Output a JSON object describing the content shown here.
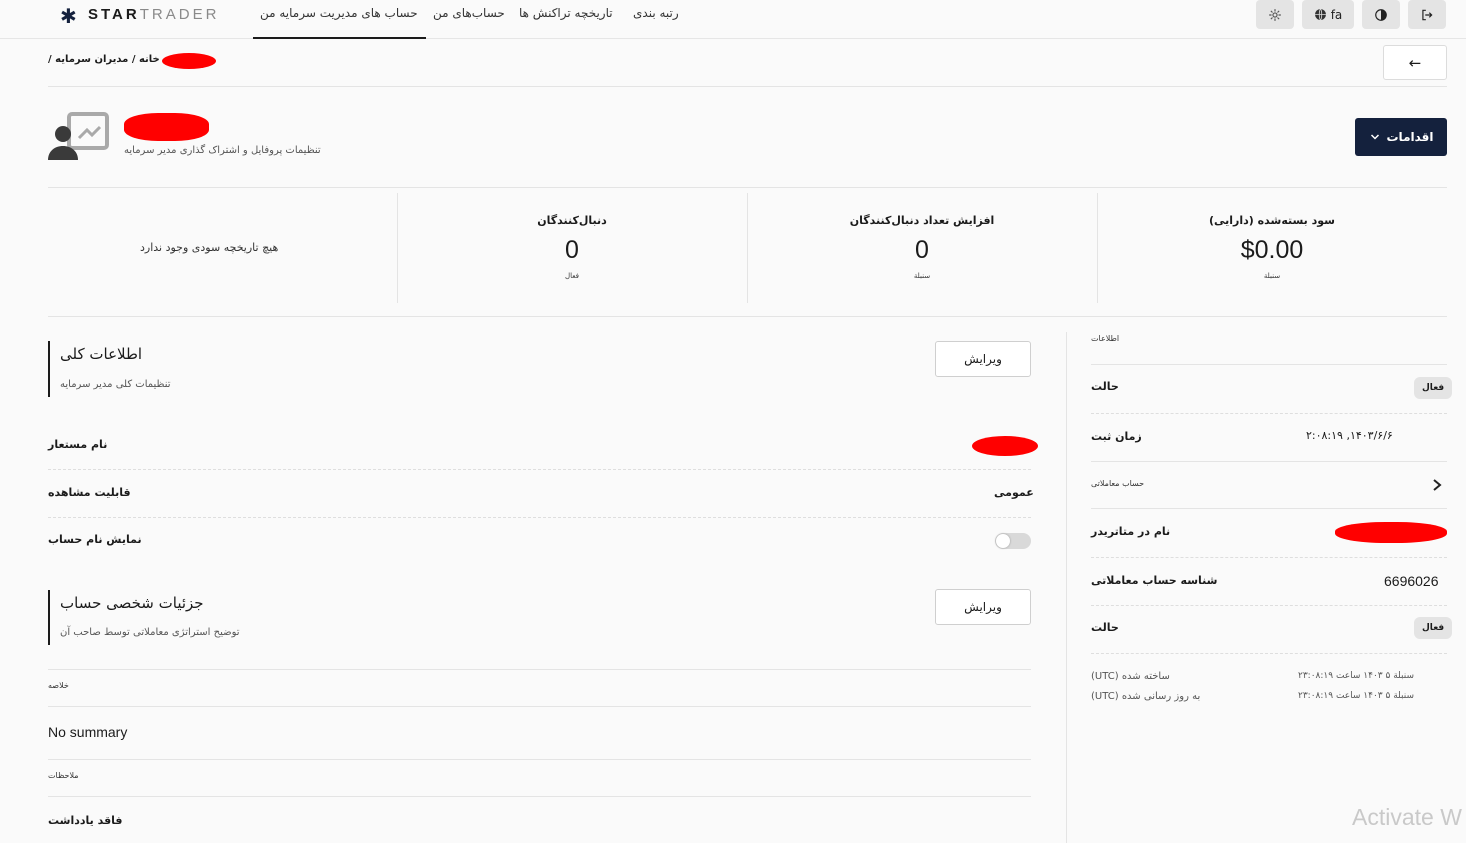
{
  "brand": {
    "logo_a": "STAR",
    "logo_b": "TRADER"
  },
  "nav": {
    "items": [
      {
        "label": "حساب های مدیریت سرمایه من",
        "active": true
      },
      {
        "label": "حساب‌های من"
      },
      {
        "label": "تاریخچه تراکنش ها"
      },
      {
        "label": "رتبه بندی"
      }
    ]
  },
  "top_actions": {
    "language": "fa"
  },
  "breadcrumb": {
    "home": "خانه",
    "sep1": "/",
    "section": "مدیران سرمایه",
    "sep2": "/"
  },
  "profile": {
    "subtitle": "تنظیمات پروفایل و اشتراک گذاری مدیر سرمایه",
    "actions_label": "اقدامات"
  },
  "stats": {
    "no_history": "هیچ تاریخچه سودی وجود ندارد",
    "followers": {
      "label": "دنبال‌کنندگان",
      "value": "0",
      "sub": "فعال"
    },
    "followers_increase": {
      "label": "افزایش تعداد دنبال‌کنندگان",
      "value": "0",
      "sub": "سنبلة"
    },
    "closed_profit": {
      "label": "سود بسته‌شده (دارایی)",
      "value": "$0.00",
      "sub": "سنبلة"
    }
  },
  "general": {
    "title": "اطلاعات کلی",
    "subtitle": "تنظیمات کلی مدیر سرمایه",
    "edit_label": "ویرایش",
    "alias_label": "نام مستعار",
    "visibility_label": "قابلیت مشاهده",
    "visibility_value": "عمومی",
    "show_account_label": "نمایش نام حساب",
    "show_account_enabled": false
  },
  "personal": {
    "title": "جزئیات شخصی حساب",
    "subtitle": "توضیح استراتژی معاملاتی توسط صاحب آن",
    "edit_label": "ویرایش",
    "summary_label": "خلاصه",
    "summary_value": "No summary",
    "notes_label": "ملاحظات",
    "notes_value": "فاقد یادداشت"
  },
  "info": {
    "header": "اطلاعات",
    "status_label": "حالت",
    "status_value": "فعال",
    "registered_label": "زمان ثبت",
    "registered_value": "۱۴۰۳/۶/۶, ۲:۰۸:۱۹",
    "trading_account_label": "حساب معاملاتی",
    "mt_name_label": "نام در متاتریدر",
    "account_id_label": "شناسه حساب معاملاتی",
    "account_id_value": "6696026",
    "status2_label": "حالت",
    "status2_value": "فعال",
    "created_label": "ساخته شده (UTC)",
    "created_value": "سنبلة ۵ ۱۴۰۳ ساعت ۲۳:۰۸:۱۹",
    "updated_label": "به روز رسانی شده (UTC)",
    "updated_value": "سنبلة ۵ ۱۴۰۳ ساعت ۲۳:۰۸:۱۹"
  },
  "watermark": "Activate W",
  "colors": {
    "primary": "#14213d",
    "redaction": "#ff0000",
    "background": "#fafafa"
  }
}
